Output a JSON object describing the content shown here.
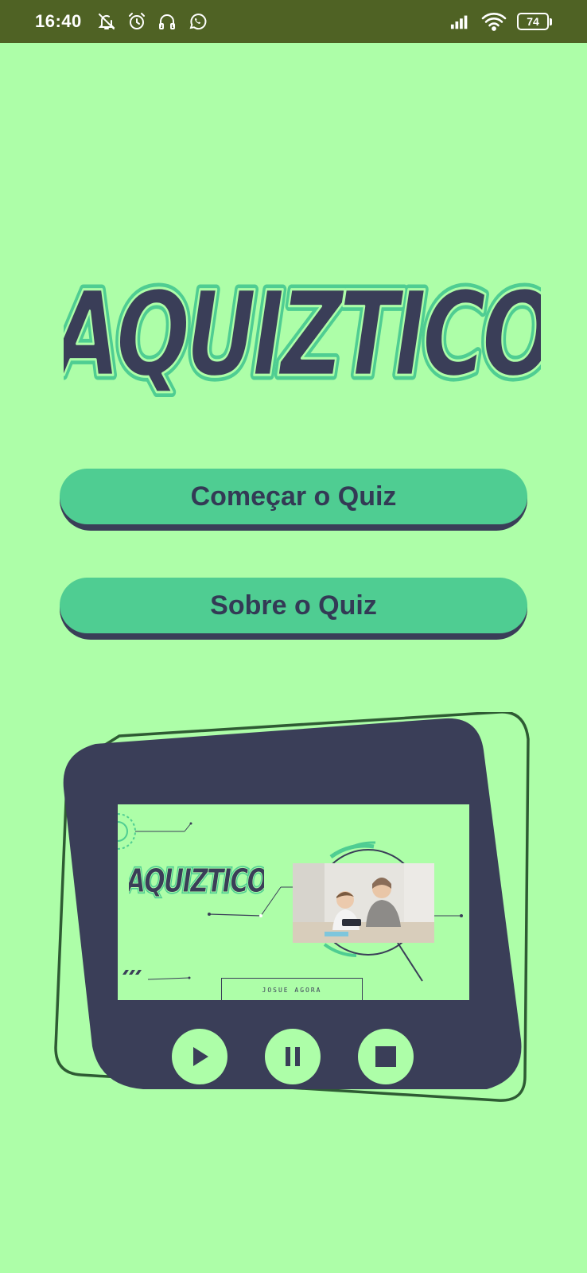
{
  "status_bar": {
    "time": "16:40",
    "left_icons": [
      "bell-off-icon",
      "alarm-icon",
      "headphones-icon",
      "whatsapp-icon"
    ],
    "right_icons": [
      "signal-icon",
      "wifi-icon",
      "battery-icon"
    ],
    "battery_level": "74"
  },
  "logo": {
    "text": "AQUIZTICO"
  },
  "buttons": {
    "start_label": "Começar o Quiz",
    "about_label": "Sobre o Quiz"
  },
  "video": {
    "logo_text": "AQUIZTICO",
    "credit": "JOSUE AGORA"
  },
  "player_controls": [
    "play-icon",
    "pause-icon",
    "stop-icon"
  ],
  "colors": {
    "background": "#adfea8",
    "status_bar": "#4f6224",
    "primary_dark": "#3a3e58",
    "button": "#4fcd92",
    "outline": "#2e5b33"
  }
}
